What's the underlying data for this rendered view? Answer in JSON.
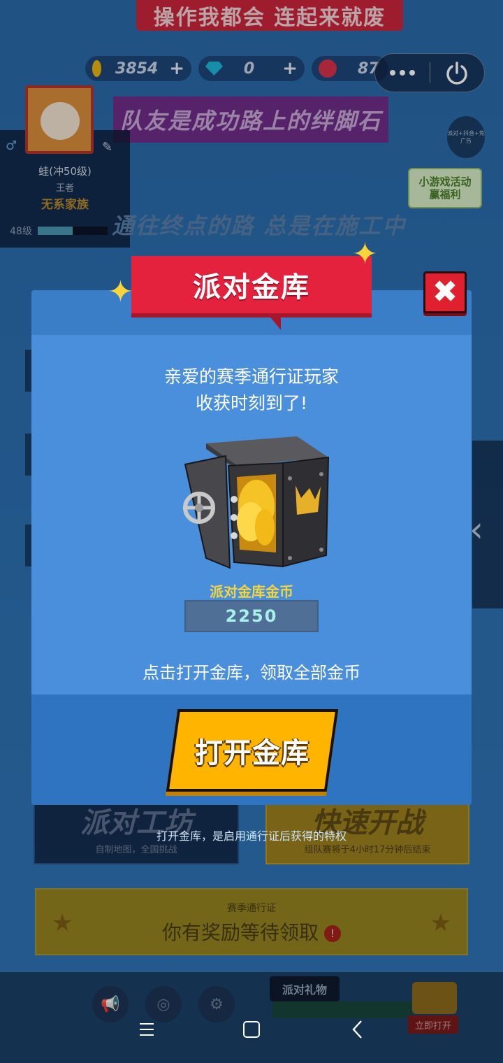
{
  "background": {
    "top_banner": "操作我都会 连起来就废",
    "currency": {
      "coins": "3854",
      "gems": "0",
      "tickets": "87"
    },
    "teammate_banner": "队友是成功路上的绊脚石",
    "profile": {
      "name": "蛙(冲50级)",
      "rank": "王者",
      "clan": "无系家族",
      "level": "48级",
      "level_progress": 0.5
    },
    "road_text": "通往终点的路 总是在施工中",
    "event_badge": {
      "line1": "小游戏活动",
      "line2": "赢福利"
    },
    "mini_badge": "派对+抖音+免广告",
    "card_workshop": {
      "title": "派对工坊",
      "subtitle": "自制地图，全国挑战"
    },
    "card_quick": {
      "title": "快速开战",
      "subtitle": "组队赛将于4小时17分钟后结束"
    },
    "season_pass": {
      "label": "赛季通行证",
      "reward": "你有奖励等待领取"
    },
    "gift": {
      "label": "派对礼物",
      "open_now": "立即打开"
    }
  },
  "dialog": {
    "title": "派对金库",
    "greeting_line1": "亲爱的赛季通行证玩家",
    "greeting_line2": "收获时刻到了!",
    "vault_label": "派对金库金币",
    "vault_value": "2250",
    "hint": "点击打开金库，领取全部金币",
    "open_button": "打开金库",
    "footnote": "打开金库，是启用通行证后获得的特权",
    "close": "✖"
  },
  "colors": {
    "accent_red": "#e5223d",
    "button_yellow": "#ffb400",
    "dialog_blue": "#4a8fdb",
    "gold_text": "#f4d53a"
  }
}
